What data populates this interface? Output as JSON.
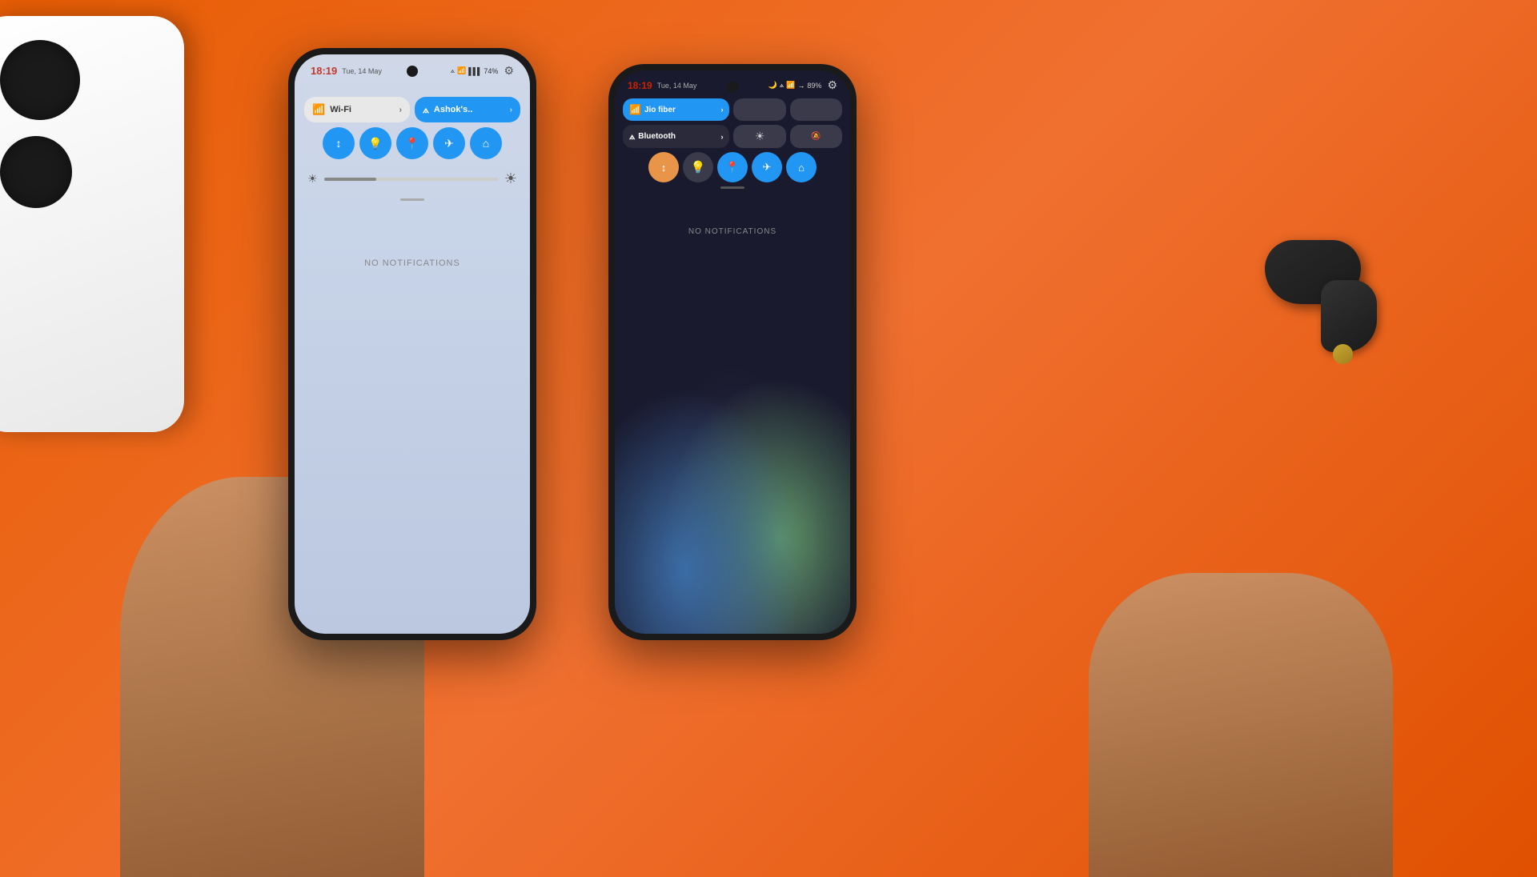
{
  "background": {
    "color": "#e85d04"
  },
  "phone1": {
    "status_bar": {
      "time": "18:19",
      "date": "Tue, 14 May",
      "battery": "74%",
      "icons": [
        "bluetooth",
        "wifi",
        "signal",
        "battery"
      ]
    },
    "quick_settings": {
      "wifi_label": "Wi-Fi",
      "wifi_active": true,
      "bt_label": "Ashok's..",
      "bt_active": true,
      "gear_icon": "⚙",
      "action_buttons": [
        {
          "icon": "↕",
          "label": "sound"
        },
        {
          "icon": "🔦",
          "label": "flashlight"
        },
        {
          "icon": "📍",
          "label": "location"
        },
        {
          "icon": "✈",
          "label": "airplane"
        },
        {
          "icon": "⌂",
          "label": "home"
        }
      ]
    },
    "no_notifications_label": "NO NOTIFICATIONS"
  },
  "phone2": {
    "status_bar": {
      "time": "18:19",
      "date": "Tue, 14 May",
      "battery": "89%",
      "icons": [
        "moon",
        "bluetooth",
        "wifi",
        "arrow",
        "battery"
      ]
    },
    "quick_settings": {
      "wifi_label": "Jio fiber",
      "wifi_active": true,
      "bt_label": "Bluetooth",
      "bt_active": false,
      "gear_icon": "⚙",
      "action_buttons": [
        {
          "icon": "↕",
          "label": "sound",
          "active": false
        },
        {
          "icon": "🔦",
          "label": "flashlight",
          "active": false
        },
        {
          "icon": "📍",
          "label": "location",
          "active": true
        },
        {
          "icon": "✈",
          "label": "airplane",
          "active": true
        },
        {
          "icon": "⌂",
          "label": "home",
          "active": true
        }
      ]
    },
    "no_notifications_label": "NO NOTIFICATIONS"
  }
}
